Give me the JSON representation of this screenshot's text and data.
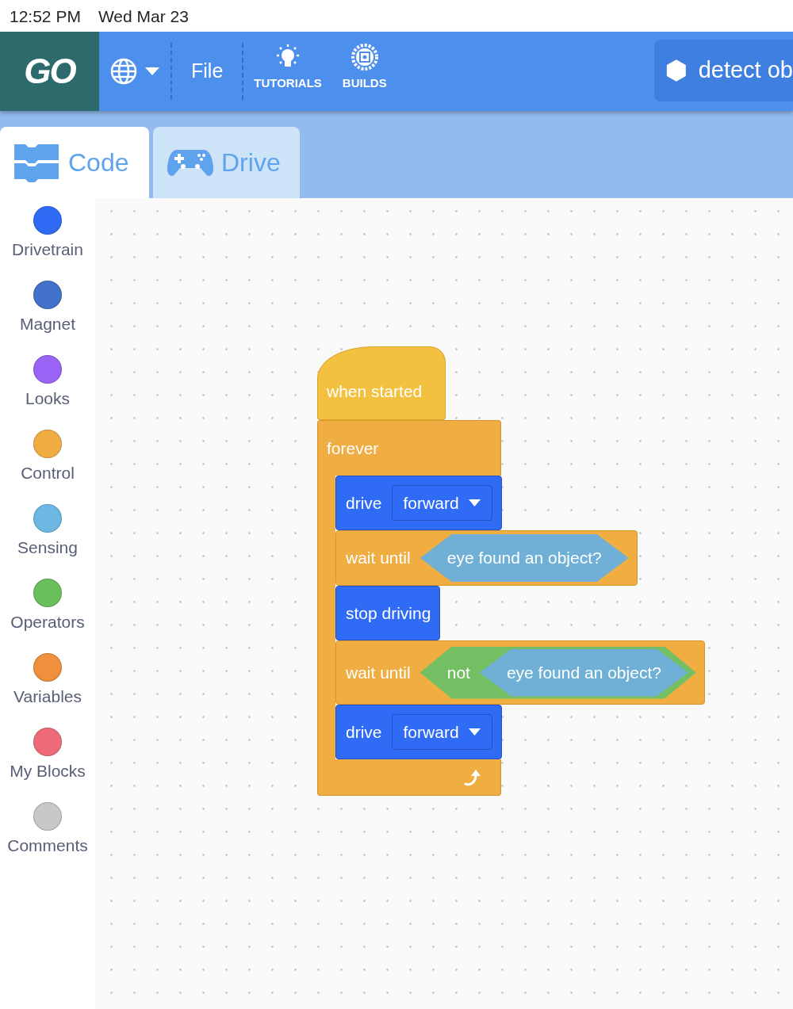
{
  "status_bar": {
    "time": "12:52 PM",
    "date": "Wed Mar 23"
  },
  "toolbar": {
    "logo": "GO",
    "menu": "File",
    "buttons": [
      {
        "label": "TUTORIALS",
        "kind": "bulb"
      },
      {
        "label": "BUILDS",
        "kind": "gear"
      }
    ],
    "project_title": "detect ob"
  },
  "tabs": [
    {
      "label": "Code",
      "kind": "code",
      "selected": true
    },
    {
      "label": "Drive",
      "kind": "gamepad",
      "selected": false
    }
  ],
  "categories": [
    {
      "label": "Drivetrain",
      "color": "#2f6bf5"
    },
    {
      "label": "Magnet",
      "color": "#4372cc"
    },
    {
      "label": "Looks",
      "color": "#9a63f5"
    },
    {
      "label": "Control",
      "color": "#f2ad42"
    },
    {
      "label": "Sensing",
      "color": "#6cb8e3"
    },
    {
      "label": "Operators",
      "color": "#6bbf5a"
    },
    {
      "label": "Variables",
      "color": "#f08f3c"
    },
    {
      "label": "My Blocks",
      "color": "#ef6b7a"
    },
    {
      "label": "Comments",
      "color": "#c8c8c8"
    }
  ],
  "script": {
    "hat": {
      "text": "when started"
    },
    "loop": {
      "text": "forever",
      "children": [
        {
          "kind": "drivetrain",
          "parts": [
            {
              "kind": "label",
              "text": "drive"
            },
            {
              "kind": "dropdown",
              "text": "forward"
            }
          ]
        },
        {
          "kind": "control",
          "parts": [
            {
              "kind": "label",
              "text": "wait until"
            },
            {
              "kind": "sensing",
              "parts": [
                {
                  "kind": "label",
                  "text": "eye found an object?"
                }
              ]
            }
          ]
        },
        {
          "kind": "drivetrain",
          "parts": [
            {
              "kind": "label",
              "text": "stop driving"
            }
          ]
        },
        {
          "kind": "control",
          "parts": [
            {
              "kind": "label",
              "text": "wait until"
            },
            {
              "kind": "operators",
              "parts": [
                {
                  "kind": "label",
                  "text": "not"
                },
                {
                  "kind": "sensing",
                  "parts": [
                    {
                      "kind": "label",
                      "text": "eye found an object?"
                    }
                  ]
                }
              ]
            }
          ]
        },
        {
          "kind": "drivetrain",
          "parts": [
            {
              "kind": "label",
              "text": "drive"
            },
            {
              "kind": "dropdown",
              "text": "forward"
            }
          ]
        }
      ]
    }
  }
}
